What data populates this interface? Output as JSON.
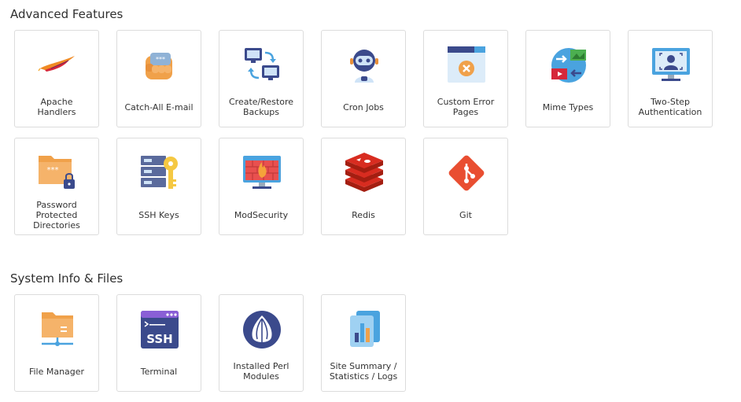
{
  "sections": [
    {
      "title": "Advanced Features"
    },
    {
      "title": "System Info & Files"
    }
  ],
  "tiles": [
    {
      "label": "Apache\nHandlers",
      "icon": "apache-feather-icon"
    },
    {
      "label": "Catch-All E-mail",
      "icon": "fist-icon"
    },
    {
      "label": "Create/Restore\nBackups",
      "icon": "backup-monitors-icon"
    },
    {
      "label": "Cron Jobs",
      "icon": "robot-icon"
    },
    {
      "label": "Custom Error\nPages",
      "icon": "error-page-icon"
    },
    {
      "label": "Mime Types",
      "icon": "mime-globe-icon"
    },
    {
      "label": "Two-Step\nAuthentication",
      "icon": "two-step-monitor-icon"
    },
    {
      "label": "Password\nProtected\nDirectories",
      "icon": "locked-folder-icon"
    },
    {
      "label": "SSH Keys",
      "icon": "server-key-icon"
    },
    {
      "label": "ModSecurity",
      "icon": "firewall-monitor-icon"
    },
    {
      "label": "Redis",
      "icon": "redis-icon"
    },
    {
      "label": "Git",
      "icon": "git-icon"
    },
    {
      "label": "File Manager",
      "icon": "file-manager-icon"
    },
    {
      "label": "Terminal",
      "icon": "ssh-terminal-icon"
    },
    {
      "label": "Installed Perl\nModules",
      "icon": "perl-onion-icon"
    },
    {
      "label": "Site Summary /\nStatistics / Logs",
      "icon": "statistics-icon"
    }
  ]
}
